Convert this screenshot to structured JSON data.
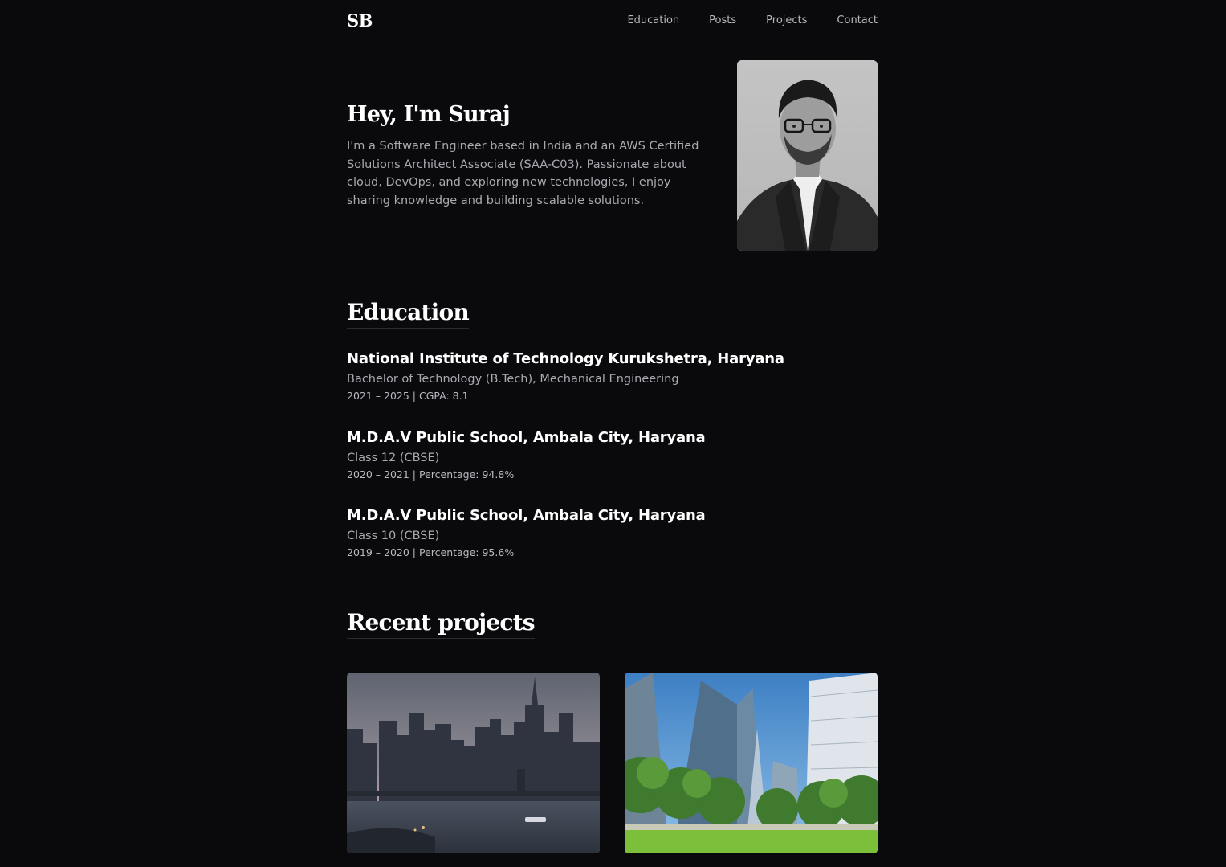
{
  "header": {
    "logo": "SB",
    "nav": [
      {
        "label": "Education"
      },
      {
        "label": "Posts"
      },
      {
        "label": "Projects"
      },
      {
        "label": "Contact"
      }
    ]
  },
  "hero": {
    "title": "Hey, I'm Suraj",
    "bio": "I'm a Software Engineer based in India and an AWS Certified Solutions Architect Associate (SAA-C03). Passionate about cloud, DevOps, and exploring new technologies, I enjoy sharing knowledge and building scalable solutions."
  },
  "education": {
    "heading": "Education",
    "items": [
      {
        "school": "National Institute of Technology Kurukshetra, Haryana",
        "degree": "Bachelor of Technology (B.Tech), Mechanical Engineering",
        "meta": "2021 – 2025 | CGPA: 8.1"
      },
      {
        "school": "M.D.A.V Public School, Ambala City, Haryana",
        "degree": "Class 12 (CBSE)",
        "meta": "2020 – 2021 | Percentage: 94.8%"
      },
      {
        "school": "M.D.A.V Public School, Ambala City, Haryana",
        "degree": "Class 10 (CBSE)",
        "meta": "2019 – 2020 | Percentage: 95.6%"
      }
    ]
  },
  "projects": {
    "heading": "Recent projects"
  },
  "colors": {
    "background": "#0a0a0d",
    "text_primary": "#ffffff",
    "text_secondary": "#a9a9b0",
    "nav_text": "#b8b8bd"
  }
}
